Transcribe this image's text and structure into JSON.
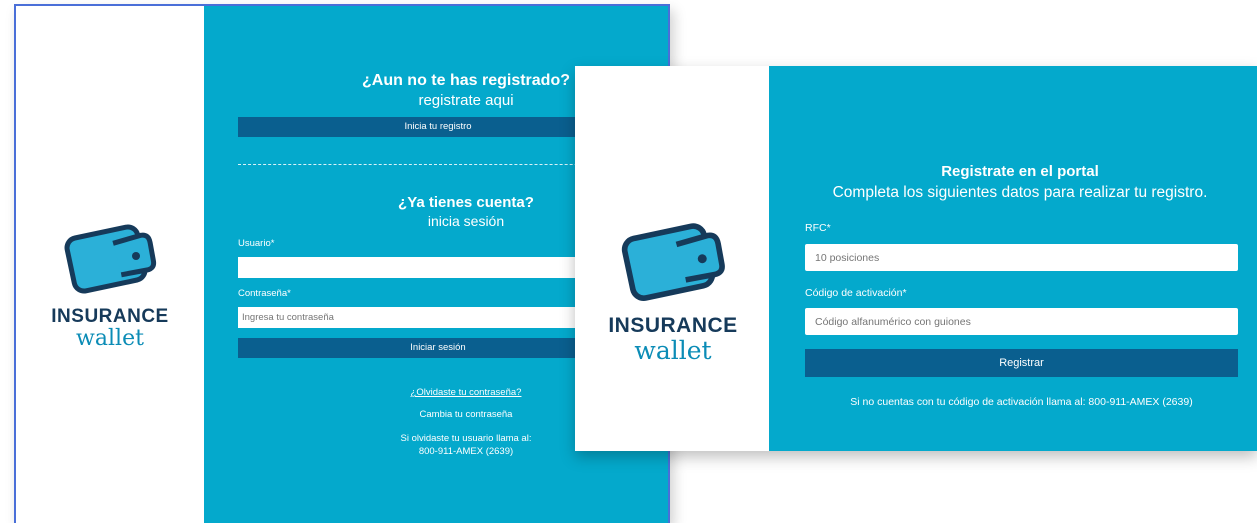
{
  "login_panel": {
    "brand_top": "INSURANCE",
    "brand_bottom": "wallet",
    "register_heading": "¿Aun no te has registrado?",
    "register_sub": "registrate aqui",
    "register_button": "Inicia tu registro",
    "login_heading": "¿Ya tienes cuenta?",
    "login_sub": "inicia sesión",
    "user_label": "Usuario*",
    "user_value": "",
    "password_label": "Contraseña*",
    "password_placeholder": "Ingresa tu contraseña",
    "login_button": "Iniciar sesión",
    "forgot_password_link": "¿Olvidaste tu contraseña?",
    "change_password": "Cambia tu contraseña",
    "forgot_user_line1": "Si olvidaste tu usuario llama al:",
    "forgot_user_line2": "800-911-AMEX (2639)"
  },
  "register_panel": {
    "brand_top": "INSURANCE",
    "brand_bottom": "wallet",
    "heading": "Registrate en el portal",
    "subheading": "Completa los siguientes datos para realizar tu registro.",
    "rfc_label": "RFC*",
    "rfc_placeholder": "10 posiciones",
    "code_label": "Código de activación*",
    "code_placeholder": "Código alfanumérico con guiones",
    "submit_button": "Registrar",
    "help_text": "Si no cuentas con tu código de activación llama al: 800-911-AMEX (2639)"
  },
  "colors": {
    "panel_blue": "#04a9cc",
    "button_blue": "#0a5f8f",
    "brand_navy": "#163a5a",
    "brand_teal": "#0b8cb6"
  },
  "icons": [
    "wallet-icon"
  ]
}
